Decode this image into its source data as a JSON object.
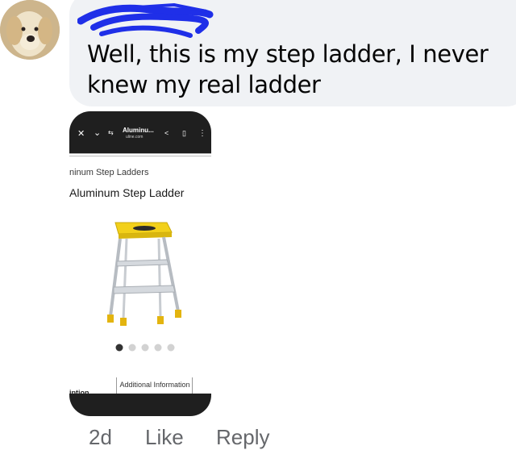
{
  "comment": {
    "text": "Well, this is my step ladder, I never knew my real ladder"
  },
  "browser": {
    "page_title": "Aluminu...",
    "domain": "uline.com"
  },
  "page": {
    "breadcrumb": "ninum Step Ladders",
    "product_title": "Aluminum Step Ladder",
    "carousel": {
      "total": 5,
      "active": 1
    },
    "tabs": [
      "iption",
      "Additional Information"
    ]
  },
  "footer": {
    "time": "2d",
    "like": "Like",
    "reply": "Reply"
  },
  "colors": {
    "bubble": "#f0f2f5",
    "scribble": "#1f2fe8",
    "ladder_yellow": "#f2d01a",
    "phone_bar": "#1f1f1f"
  }
}
